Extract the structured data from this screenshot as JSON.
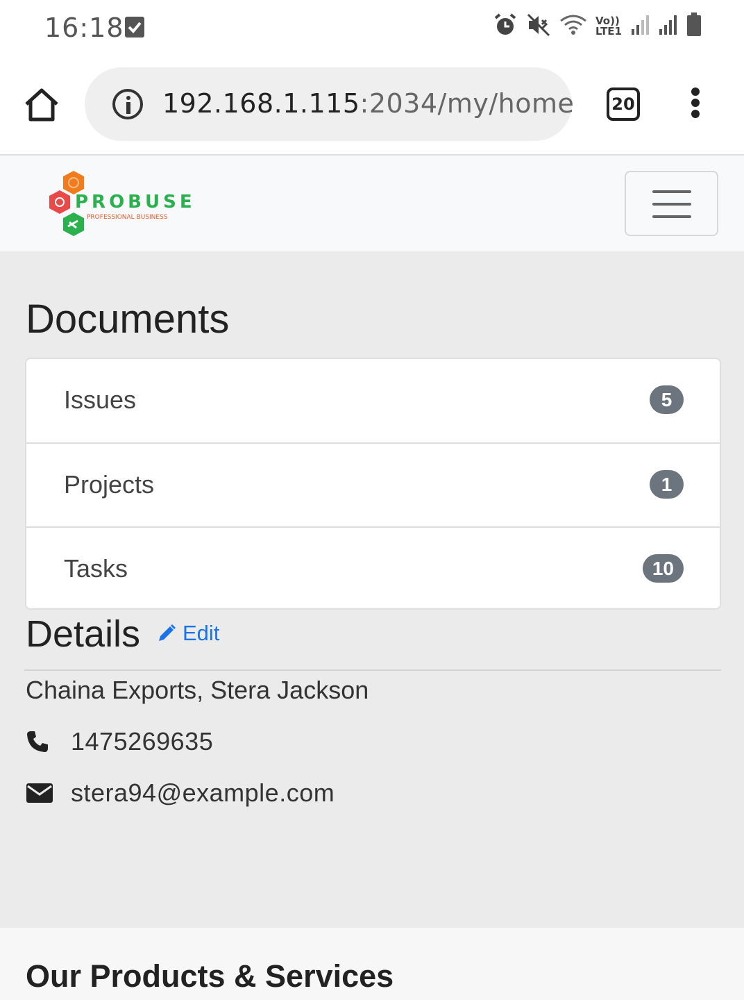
{
  "status_bar": {
    "time": "16:18",
    "icons": [
      "checkbox-notification-icon",
      "alarm-icon",
      "mute-icon",
      "wifi-icon",
      "volte-icon",
      "signal-icon",
      "signal-icon",
      "battery-icon"
    ],
    "volte_label_top": "Vo))",
    "volte_label_bottom": "LTE1"
  },
  "browser": {
    "url_host": "192.168.1.115",
    "url_path": ":2034/my/home",
    "tab_count": "20"
  },
  "navbar": {
    "logo_word": "PROBUSE",
    "logo_sub": "PROFESSIONAL BUSINESS"
  },
  "documents": {
    "heading": "Documents",
    "items": [
      {
        "label": "Issues",
        "count": "5"
      },
      {
        "label": "Projects",
        "count": "1"
      },
      {
        "label": "Tasks",
        "count": "10"
      }
    ]
  },
  "details": {
    "heading": "Details",
    "edit_label": "Edit",
    "company": "Chaina Exports, Stera Jackson",
    "phone": "1475269635",
    "email": "stera94@example.com"
  },
  "footer": {
    "title": "Our Products & Services"
  },
  "colors": {
    "accent_link": "#1a73e8",
    "badge": "#6c757d",
    "logo_green": "#2ab14d",
    "logo_orange": "#f07c1e",
    "logo_red": "#e84a4a"
  }
}
